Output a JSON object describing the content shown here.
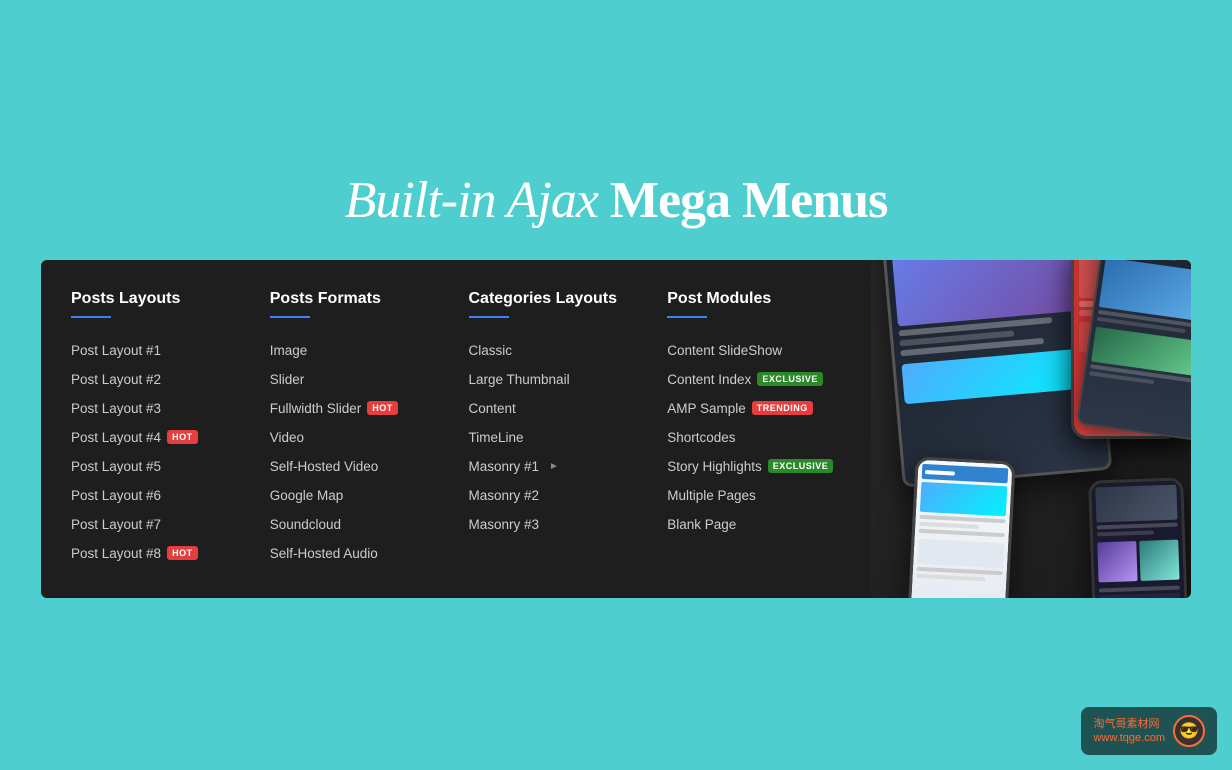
{
  "page": {
    "background_color": "#4ecece",
    "headline": {
      "italic_part": "Built-in Ajax ",
      "bold_part": "Mega Menus"
    }
  },
  "mega_menu": {
    "columns": [
      {
        "id": "posts-layouts",
        "title": "Posts Layouts",
        "items": [
          {
            "label": "Post Layout #1",
            "badge": null
          },
          {
            "label": "Post Layout #2",
            "badge": null
          },
          {
            "label": "Post Layout #3",
            "badge": null
          },
          {
            "label": "Post Layout #4",
            "badge": "HOT"
          },
          {
            "label": "Post Layout #5",
            "badge": null
          },
          {
            "label": "Post Layout #6",
            "badge": null
          },
          {
            "label": "Post Layout #7",
            "badge": null
          },
          {
            "label": "Post Layout #8",
            "badge": "HOT"
          }
        ]
      },
      {
        "id": "posts-formats",
        "title": "Posts Formats",
        "items": [
          {
            "label": "Image",
            "badge": null
          },
          {
            "label": "Slider",
            "badge": null
          },
          {
            "label": "Fullwidth Slider",
            "badge": "HOT"
          },
          {
            "label": "Video",
            "badge": null
          },
          {
            "label": "Self-Hosted Video",
            "badge": null
          },
          {
            "label": "Google Map",
            "badge": null
          },
          {
            "label": "Soundcloud",
            "badge": null
          },
          {
            "label": "Self-Hosted Audio",
            "badge": null
          }
        ]
      },
      {
        "id": "categories-layouts",
        "title": "Categories Layouts",
        "items": [
          {
            "label": "Classic",
            "badge": null,
            "arrow": false
          },
          {
            "label": "Large Thumbnail",
            "badge": null,
            "arrow": false
          },
          {
            "label": "Content",
            "badge": null,
            "arrow": false
          },
          {
            "label": "TimeLine",
            "badge": null,
            "arrow": false
          },
          {
            "label": "Masonry #1",
            "badge": null,
            "arrow": true
          },
          {
            "label": "Masonry #2",
            "badge": null,
            "arrow": false
          },
          {
            "label": "Masonry #3",
            "badge": null,
            "arrow": false
          }
        ]
      },
      {
        "id": "post-modules",
        "title": "Post Modules",
        "items": [
          {
            "label": "Content SlideShow",
            "badge": null
          },
          {
            "label": "Content Index",
            "badge": "EXCLUSIVE"
          },
          {
            "label": "AMP Sample",
            "badge": "TRENDING"
          },
          {
            "label": "Shortcodes",
            "badge": null
          },
          {
            "label": "Story Highlights",
            "badge": "EXCLUSIVE"
          },
          {
            "label": "Multiple Pages",
            "badge": null
          },
          {
            "label": "Blank Page",
            "badge": null
          }
        ]
      }
    ]
  },
  "watermark": {
    "line1": "淘气哥素材网",
    "line2": "www.tqge.com"
  }
}
